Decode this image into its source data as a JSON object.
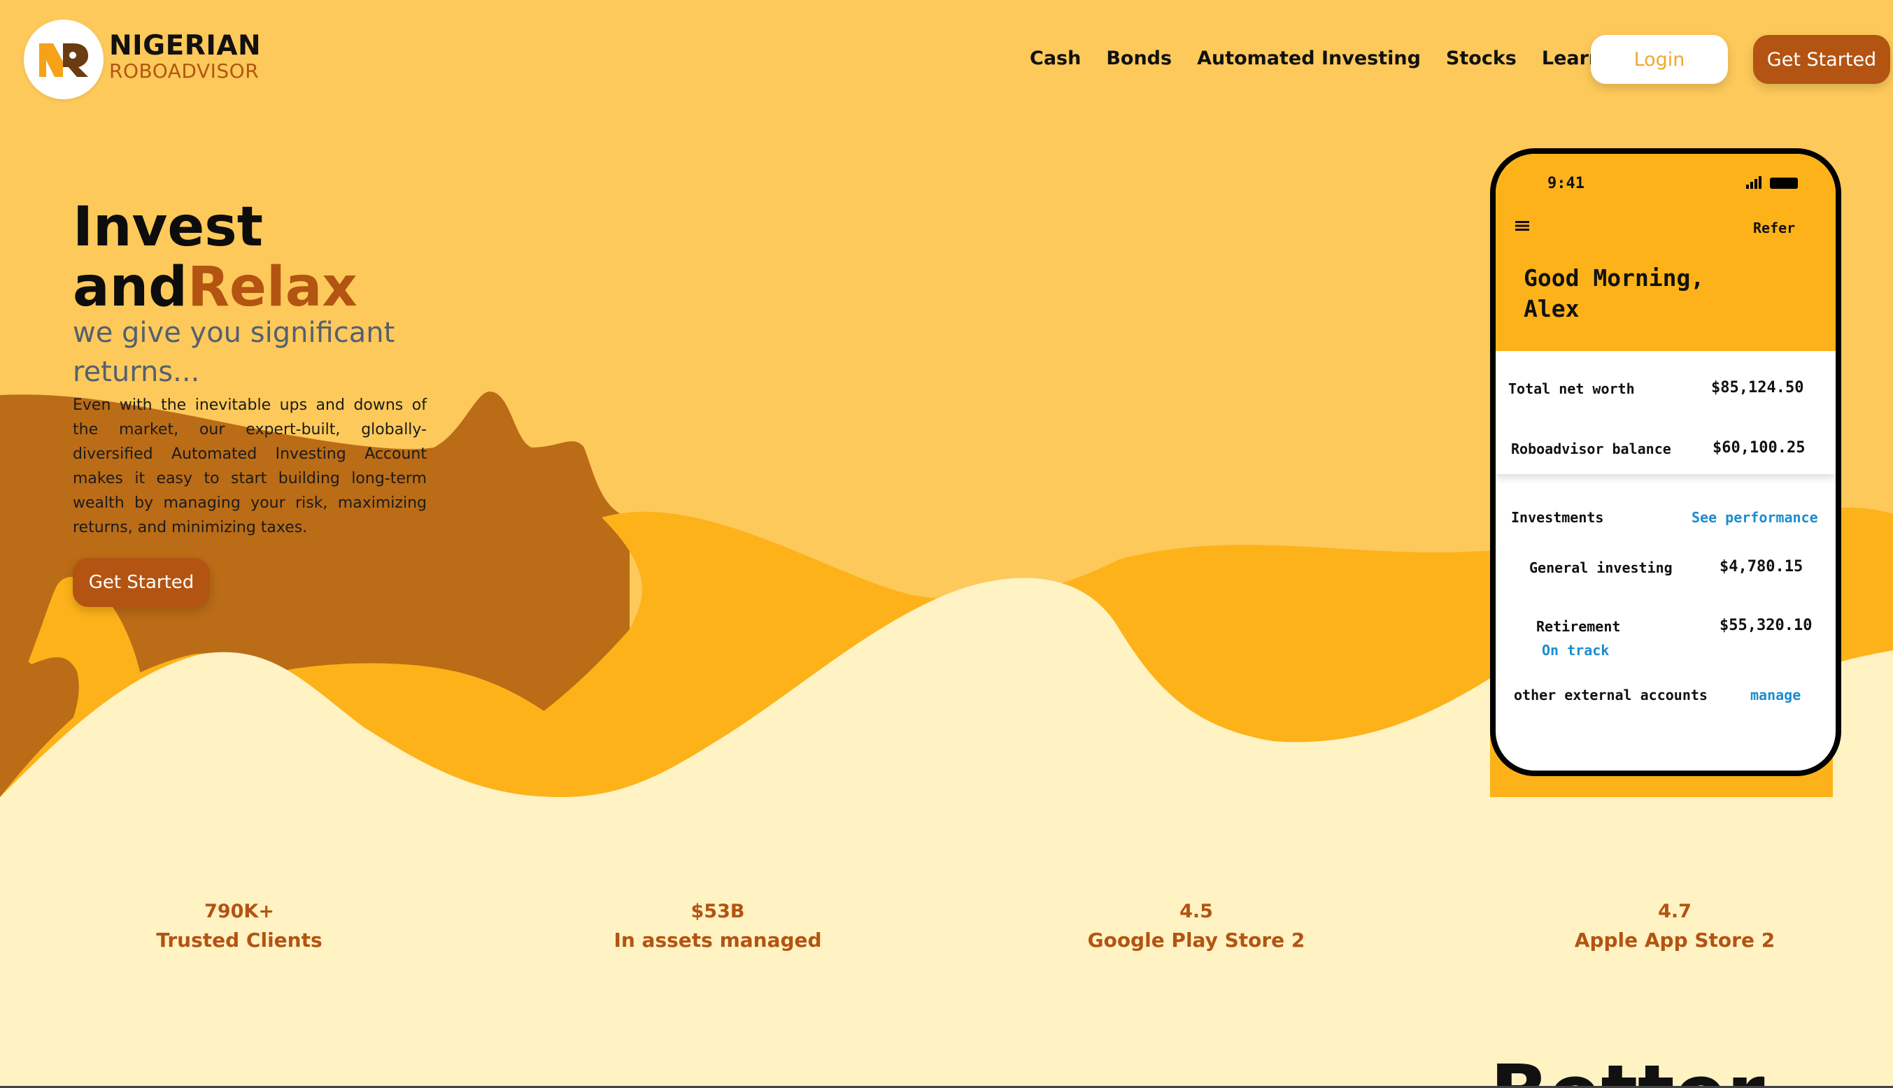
{
  "brand": {
    "name": "NIGERIAN",
    "sub": "ROBOADVISOR"
  },
  "nav": {
    "items": [
      "Cash",
      "Bonds",
      "Automated Investing",
      "Stocks",
      "Learn"
    ]
  },
  "header": {
    "login_label": "Login",
    "get_started_label": "Get Started"
  },
  "hero": {
    "title_line1": "Invest",
    "title_line2_a": "and",
    "title_line2_b": "Relax",
    "subtitle": "we give you significant returns...",
    "body": "Even with the inevitable ups and downs of the market, our expert-built, globally-diversified Automated Investing Account makes it easy to start building long-term wealth by managing your risk, maximizing returns, and minimizing taxes.",
    "cta_label": "Get Started"
  },
  "phone": {
    "time": "9:41",
    "refer": "Refer",
    "greeting_line1": "Good Morning,",
    "greeting_line2": "Alex",
    "net_worth_label": "Total net worth",
    "net_worth_value": "$85,124.50",
    "robo_label": "Roboadvisor balance",
    "robo_value": "$60,100.25",
    "investments_label": "Investments",
    "see_performance": "See performance",
    "general_label": "General investing",
    "general_value": "$4,780.15",
    "retirement_label": "Retirement",
    "retirement_value": "$55,320.10",
    "on_track": "On track",
    "external_label": "other external accounts",
    "manage": "manage"
  },
  "stats": [
    {
      "value": "790K+",
      "label": "Trusted Clients"
    },
    {
      "value": "$53B",
      "label": "In assets managed"
    },
    {
      "value": "4.5",
      "label": "Google Play Store 2"
    },
    {
      "value": "4.7",
      "label": "Apple App Store 2"
    }
  ],
  "next_section": {
    "heading": "Better"
  },
  "colors": {
    "accent": "#b35412",
    "background": "#fdc95a",
    "cream": "#fff2c3",
    "gold": "#fdb219",
    "link": "#1d8ccf"
  }
}
